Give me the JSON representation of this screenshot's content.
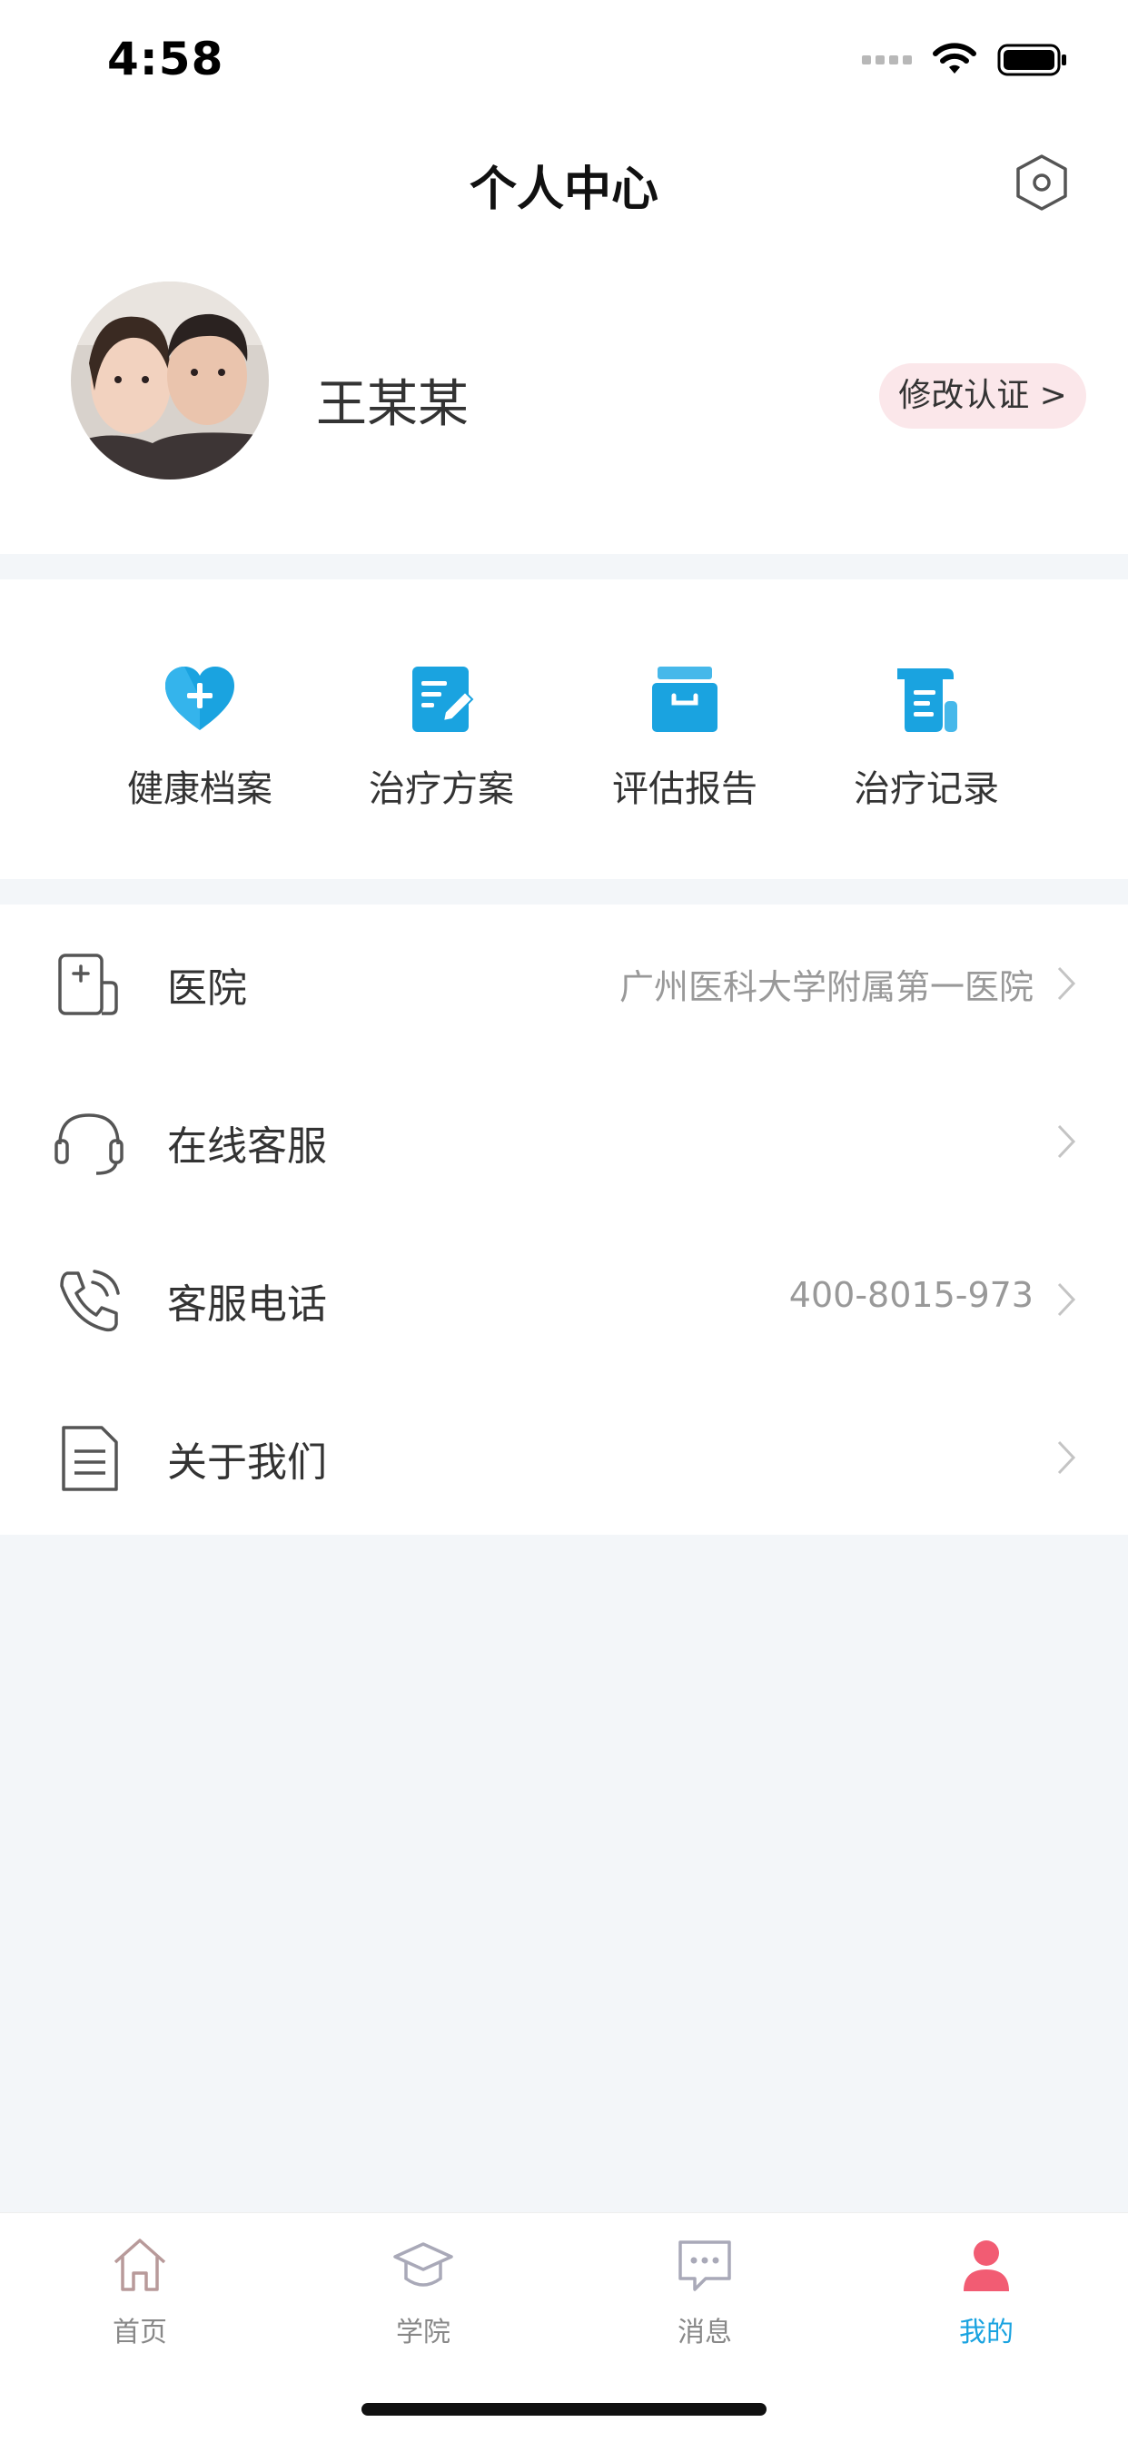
{
  "status_bar": {
    "time": "4:58"
  },
  "header": {
    "title": "个人中心"
  },
  "profile": {
    "name": "王某某",
    "badge": "修改认证 >"
  },
  "quick_actions": [
    {
      "label": "健康档案",
      "icon": "heart-plus-icon"
    },
    {
      "label": "治疗方案",
      "icon": "edit-document-icon"
    },
    {
      "label": "评估报告",
      "icon": "archive-box-icon"
    },
    {
      "label": "治疗记录",
      "icon": "scroll-record-icon"
    }
  ],
  "menu": [
    {
      "label": "医院",
      "value": "广州医科大学附属第一医院",
      "icon": "hospital-icon"
    },
    {
      "label": "在线客服",
      "value": "",
      "icon": "headset-icon"
    },
    {
      "label": "客服电话",
      "value": "400-8015-973",
      "icon": "phone-icon"
    },
    {
      "label": "关于我们",
      "value": "",
      "icon": "document-icon"
    }
  ],
  "tabbar": [
    {
      "label": "首页",
      "icon": "home-icon"
    },
    {
      "label": "学院",
      "icon": "graduation-cap-icon"
    },
    {
      "label": "消息",
      "icon": "message-bubble-icon"
    },
    {
      "label": "我的",
      "icon": "user-icon",
      "active": true
    }
  ],
  "colors": {
    "accent": "#1aa3e0",
    "tab_active_icon": "#f25c73",
    "badge_bg": "#fbe7ea",
    "page_bg": "#f3f6f9"
  }
}
